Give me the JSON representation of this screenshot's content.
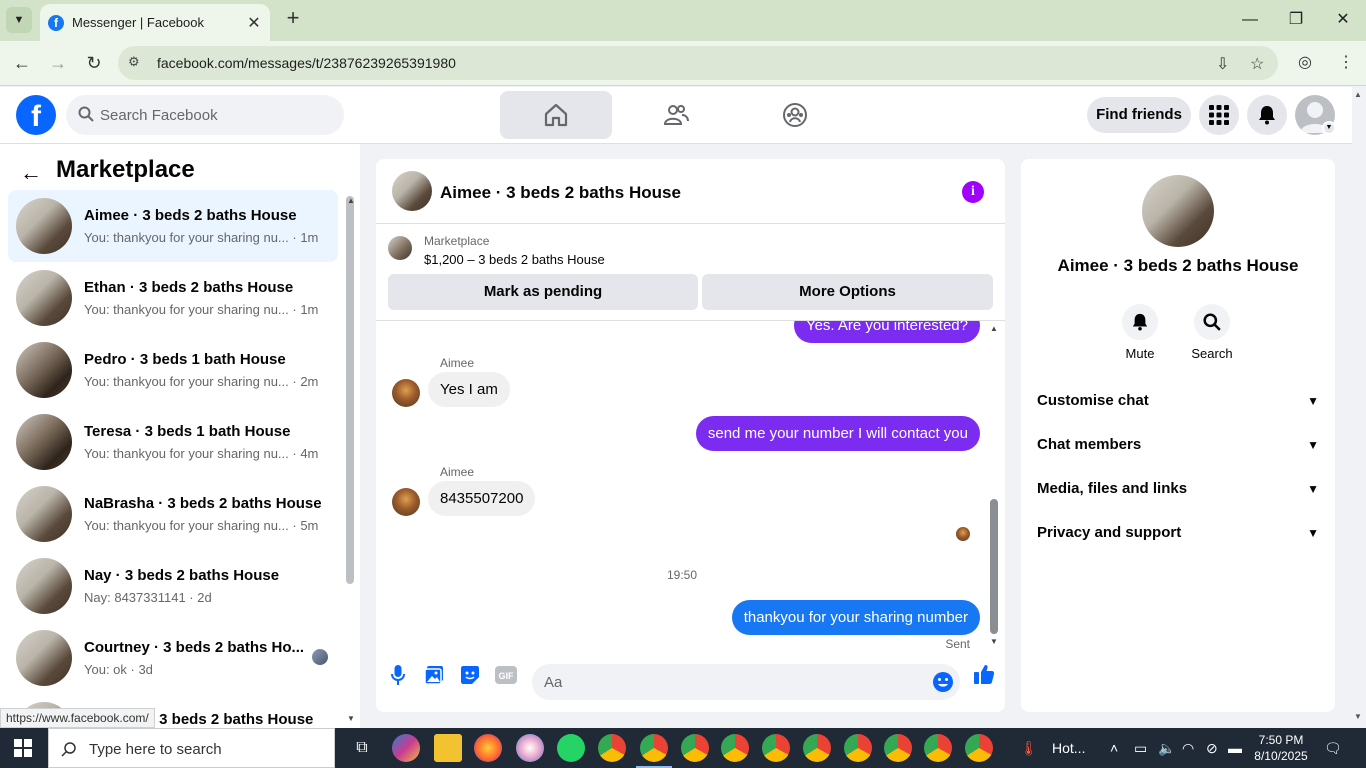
{
  "browser": {
    "tab_title": "Messenger | Facebook",
    "url": "facebook.com/messages/t/23876239265391980",
    "status_link": "https://www.facebook.com/"
  },
  "facebook": {
    "search_placeholder": "Search Facebook",
    "find_friends": "Find friends"
  },
  "sidebar": {
    "title": "Marketplace",
    "conversations": [
      {
        "name": "Aimee · 3 beds 2 baths House",
        "snippet": "You: thankyou for your sharing nu... · 1m"
      },
      {
        "name": "Ethan · 3 beds 2 baths House",
        "snippet": "You: thankyou for your sharing nu... · 1m"
      },
      {
        "name": "Pedro · 3 beds 1 bath House",
        "snippet": "You: thankyou for your sharing nu... · 2m"
      },
      {
        "name": "Teresa · 3 beds 1 bath House",
        "snippet": "You: thankyou for your sharing nu... · 4m"
      },
      {
        "name": "NaBrasha · 3 beds 2 baths House",
        "snippet": "You: thankyou for your sharing nu... · 5m"
      },
      {
        "name": "Nay · 3 beds 2 baths House",
        "snippet": "Nay: 8437331141 · 2d"
      },
      {
        "name": "Courtney · 3 beds 2 baths Ho...",
        "snippet": "You: ok · 3d"
      },
      {
        "name": "· 3 beds 2 baths House",
        "snippet": ""
      }
    ]
  },
  "chat": {
    "title": "Aimee · 3 beds 2 baths House",
    "marketplace_label": "Marketplace",
    "listing": "$1,200 – 3 beds 2 baths House",
    "mark_pending": "Mark as pending",
    "more_options": "More Options",
    "messages": {
      "m0": "Yes. Are you interested?",
      "sender1": "Aimee",
      "m1": "Yes I am",
      "m2": "send me your number I will contact you",
      "sender2": "Aimee",
      "m3": "8435507200",
      "time": "19:50",
      "m4": "thankyou for your sharing number",
      "sent": "Sent"
    },
    "composer_placeholder": "Aa",
    "colors": {
      "outgoing": "#7b2cf0",
      "outgoing_last": "#1877f2",
      "accent": "#a100ff"
    }
  },
  "right_panel": {
    "name": "Aimee · 3 beds 2 baths House",
    "mute": "Mute",
    "search": "Search",
    "rows": [
      "Customise chat",
      "Chat members",
      "Media, files and links",
      "Privacy and support"
    ]
  },
  "taskbar": {
    "search_placeholder": "Type here to search",
    "weather": "Hot...",
    "time": "7:50 PM",
    "date": "8/10/2025"
  }
}
